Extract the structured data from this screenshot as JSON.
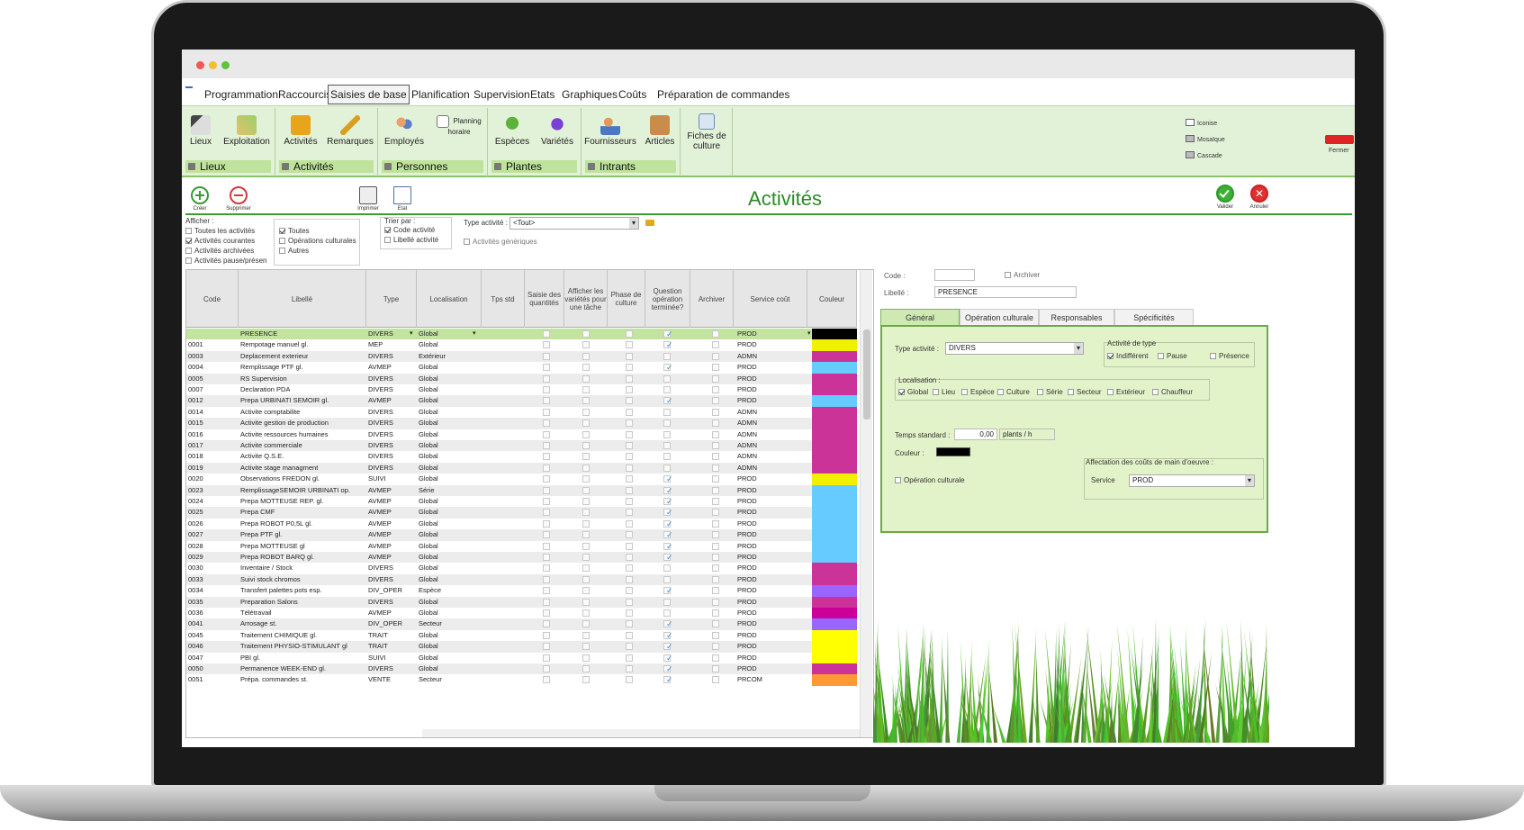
{
  "menu": [
    "Programmation",
    "Raccourcis",
    "Saisies de base",
    "Planification",
    "Supervision",
    "Etats",
    "Graphiques",
    "Coûts",
    "Préparation de commandes"
  ],
  "menu_active": "Saisies de base",
  "ribbon": {
    "groups": [
      {
        "label": "Lieux",
        "buttons": [
          "Lieux",
          "Exploitation"
        ]
      },
      {
        "label": "Activités",
        "buttons": [
          "Activités",
          "Remarques"
        ]
      },
      {
        "label": "Personnes",
        "buttons": [
          "Employés",
          "Planning horaire"
        ]
      },
      {
        "label": "Plantes",
        "buttons": [
          "Espèces",
          "Variétés"
        ]
      },
      {
        "label": "Intrants",
        "buttons": [
          "Fournisseurs",
          "Articles"
        ]
      }
    ],
    "fiches": "Fiches de culture",
    "window": {
      "iconise": "Iconise",
      "mosaique": "Mosaïque",
      "cascade": "Cascade",
      "fermer": "Fermer"
    }
  },
  "toolbar": {
    "creer": "Créer",
    "supprimer": "Supprimer",
    "imprimer": "Imprimer",
    "etat": "Etat",
    "valider": "Valider",
    "annuler": "Annuler"
  },
  "page_title": "Activités",
  "filters": {
    "afficher_label": "Afficher :",
    "afficher": [
      {
        "label": "Toutes les activités",
        "checked": false
      },
      {
        "label": "Activités courantes",
        "checked": true
      },
      {
        "label": "Activités archivées",
        "checked": false
      },
      {
        "label": "Activités pause/présen",
        "checked": false
      }
    ],
    "types": [
      {
        "label": "Toutes",
        "checked": true
      },
      {
        "label": "Opérations culturales",
        "checked": false
      },
      {
        "label": "Autres",
        "checked": false
      }
    ],
    "trier_label": "Trier par :",
    "trier": [
      {
        "label": "Code activité",
        "checked": true
      },
      {
        "label": "Libellé activité",
        "checked": false
      }
    ],
    "type_activite_label": "Type activité :",
    "type_activite_value": "<Tout>",
    "generiques": "Activités génériques"
  },
  "grid": {
    "columns": [
      "Code",
      "Libellé",
      "Type",
      "Localisation",
      "Tps std",
      "Saisie des quantités",
      "Afficher les variétés pour une tâche",
      "Phase de culture",
      "Question opération terminée?",
      "Archiver",
      "Service coût",
      "Couleur"
    ],
    "rows": [
      {
        "code": "",
        "libelle": "PRESENCE",
        "type": "DIVERS",
        "loc": "Global",
        "q": true,
        "service": "PROD",
        "color": "#000000"
      },
      {
        "code": "0001",
        "libelle": "Rempotage manuel gl.",
        "type": "MEP",
        "loc": "Global",
        "q": true,
        "service": "PROD",
        "color": "#f0f000"
      },
      {
        "code": "0003",
        "libelle": "Deplacement exterieur",
        "type": "DIVERS",
        "loc": "Extérieur",
        "q": false,
        "service": "ADMN",
        "color": "#cc3399"
      },
      {
        "code": "0004",
        "libelle": "Remplissage PTF gl.",
        "type": "AVMEP",
        "loc": "Global",
        "q": true,
        "service": "PROD",
        "color": "#66ccff"
      },
      {
        "code": "0005",
        "libelle": "RS Supervision",
        "type": "DIVERS",
        "loc": "Global",
        "q": false,
        "service": "PROD",
        "color": "#cc3399"
      },
      {
        "code": "0007",
        "libelle": "Declaration PDA",
        "type": "DIVERS",
        "loc": "Global",
        "q": false,
        "service": "PROD",
        "color": "#cc3399"
      },
      {
        "code": "0012",
        "libelle": "Prepa URBINATI SEMOIR gl.",
        "type": "AVMEP",
        "loc": "Global",
        "q": true,
        "service": "PROD",
        "color": "#66ccff"
      },
      {
        "code": "0014",
        "libelle": "Activite comptabilite",
        "type": "DIVERS",
        "loc": "Global",
        "q": false,
        "service": "ADMN",
        "color": "#cc3399"
      },
      {
        "code": "0015",
        "libelle": "Activite gestion de production",
        "type": "DIVERS",
        "loc": "Global",
        "q": false,
        "service": "ADMN",
        "color": "#cc3399"
      },
      {
        "code": "0016",
        "libelle": "Activite ressources humaines",
        "type": "DIVERS",
        "loc": "Global",
        "q": false,
        "service": "ADMN",
        "color": "#cc3399"
      },
      {
        "code": "0017",
        "libelle": "Activite commerciale",
        "type": "DIVERS",
        "loc": "Global",
        "q": false,
        "service": "ADMN",
        "color": "#cc3399"
      },
      {
        "code": "0018",
        "libelle": "Activite Q.S.E.",
        "type": "DIVERS",
        "loc": "Global",
        "q": false,
        "service": "ADMN",
        "color": "#cc3399"
      },
      {
        "code": "0019",
        "libelle": "Activite stage managment",
        "type": "DIVERS",
        "loc": "Global",
        "q": false,
        "service": "ADMN",
        "color": "#cc3399"
      },
      {
        "code": "0020",
        "libelle": "Observations FREDON gl.",
        "type": "SUIVI",
        "loc": "Global",
        "q": true,
        "service": "PROD",
        "color": "#f0f000"
      },
      {
        "code": "0023",
        "libelle": "RemplissageSEMOIR URBINATI op.",
        "type": "AVMEP",
        "loc": "Série",
        "q": true,
        "service": "PROD",
        "color": "#66ccff"
      },
      {
        "code": "0024",
        "libelle": "Prepa MOTTEUSE REP. gl.",
        "type": "AVMEP",
        "loc": "Global",
        "q": true,
        "service": "PROD",
        "color": "#66ccff"
      },
      {
        "code": "0025",
        "libelle": "Prepa CMF",
        "type": "AVMEP",
        "loc": "Global",
        "q": true,
        "service": "PROD",
        "color": "#66ccff"
      },
      {
        "code": "0026",
        "libelle": "Prepa ROBOT P0,5L gl.",
        "type": "AVMEP",
        "loc": "Global",
        "q": true,
        "service": "PROD",
        "color": "#66ccff"
      },
      {
        "code": "0027",
        "libelle": "Prepa PTF gl.",
        "type": "AVMEP",
        "loc": "Global",
        "q": true,
        "service": "PROD",
        "color": "#66ccff"
      },
      {
        "code": "0028",
        "libelle": "Prepa MOTTEUSE gl",
        "type": "AVMEP",
        "loc": "Global",
        "q": true,
        "service": "PROD",
        "color": "#66ccff"
      },
      {
        "code": "0029",
        "libelle": "Prepa ROBOT BARQ gl.",
        "type": "AVMEP",
        "loc": "Global",
        "q": true,
        "service": "PROD",
        "color": "#66ccff"
      },
      {
        "code": "0030",
        "libelle": "Inventaire / Stock",
        "type": "DIVERS",
        "loc": "Global",
        "q": false,
        "service": "PROD",
        "color": "#cc3399"
      },
      {
        "code": "0033",
        "libelle": "Suivi stock chromos",
        "type": "DIVERS",
        "loc": "Global",
        "q": false,
        "service": "PROD",
        "color": "#cc3399"
      },
      {
        "code": "0034",
        "libelle": "Transfert palettes pots esp.",
        "type": "DIV_OPER",
        "loc": "Espèce",
        "q": true,
        "service": "PROD",
        "color": "#9966ff"
      },
      {
        "code": "0035",
        "libelle": "Preparation Salons",
        "type": "DIVERS",
        "loc": "Global",
        "q": false,
        "service": "PROD",
        "color": "#cc3399"
      },
      {
        "code": "0036",
        "libelle": "Télétravail",
        "type": "AVMEP",
        "loc": "Global",
        "q": false,
        "service": "PROD",
        "color": "#cc0099"
      },
      {
        "code": "0041",
        "libelle": "Arrosage st.",
        "type": "DIV_OPER",
        "loc": "Secteur",
        "q": true,
        "service": "PROD",
        "color": "#9966ff"
      },
      {
        "code": "0045",
        "libelle": "Traitement CHIMIQUE gl.",
        "type": "TRAIT",
        "loc": "Global",
        "q": true,
        "service": "PROD",
        "color": "#ffff00"
      },
      {
        "code": "0046",
        "libelle": "Traitement PHYSIO-STIMULANT gl",
        "type": "TRAIT",
        "loc": "Global",
        "q": true,
        "service": "PROD",
        "color": "#ffff00"
      },
      {
        "code": "0047",
        "libelle": "PBI gl.",
        "type": "SUIVI",
        "loc": "Global",
        "q": true,
        "service": "PROD",
        "color": "#ffff00"
      },
      {
        "code": "0050",
        "libelle": "Permanence WEEK-END gl.",
        "type": "DIVERS",
        "loc": "Global",
        "q": true,
        "service": "PROD",
        "color": "#cc3399"
      },
      {
        "code": "0051",
        "libelle": "Prépa. commandes st.",
        "type": "VENTE",
        "loc": "Secteur",
        "q": true,
        "service": "PRCOM",
        "color": "#ff9933"
      }
    ]
  },
  "detail": {
    "code_label": "Code :",
    "code_value": "",
    "archiver_label": "Archiver",
    "libelle_label": "Libellé :",
    "libelle_value": "PRESENCE",
    "tabs": [
      "Général",
      "Opération culturale",
      "Responsables",
      "Spécificités"
    ],
    "type_activite_label": "Type activité :",
    "type_activite_value": "DIVERS",
    "activite_de_type_label": "Activité de type",
    "activite_de_type": [
      {
        "label": "Indifférent",
        "checked": true
      },
      {
        "label": "Pause",
        "checked": false
      },
      {
        "label": "Présence",
        "checked": false
      }
    ],
    "localisation_label": "Localisation :",
    "localisation": [
      {
        "label": "Global",
        "checked": true
      },
      {
        "label": "Lieu",
        "checked": false
      },
      {
        "label": "Espèce",
        "checked": false
      },
      {
        "label": "Culture",
        "checked": false
      },
      {
        "label": "Série",
        "checked": false
      },
      {
        "label": "Secteur",
        "checked": false
      },
      {
        "label": "Extérieur",
        "checked": false
      },
      {
        "label": "Chauffeur",
        "checked": false
      }
    ],
    "temps_label": "Temps standard :",
    "temps_value": "0,00",
    "temps_unit": "plants / h",
    "couleur_label": "Couleur :",
    "couleur_value": "#000000",
    "operation_label": "Opération culturale",
    "affectation_label": "Affectation des coûts de main d'oeuvre :",
    "service_label": "Service",
    "service_value": "PROD"
  },
  "colors": {
    "accent_green": "#2b8a25",
    "ribbon_bg": "#e2f2d8",
    "panel_bg": "#e3f3c9",
    "selected_row": "#c3e49e"
  }
}
